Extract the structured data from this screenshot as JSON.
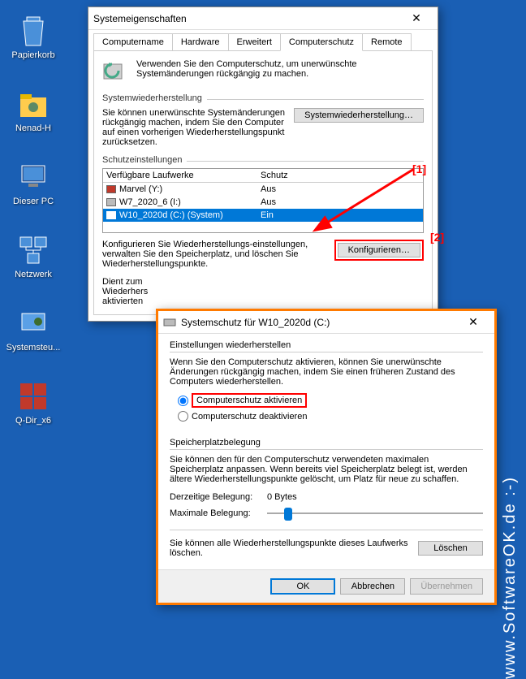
{
  "desktop": {
    "icons": [
      {
        "label": "Papierkorb"
      },
      {
        "label": "Nenad-H"
      },
      {
        "label": "Dieser PC"
      },
      {
        "label": "Netzwerk"
      },
      {
        "label": "Systemsteu..."
      },
      {
        "label": "Q-Dir_x6"
      }
    ]
  },
  "win1": {
    "title": "Systemeigenschaften",
    "tabs": [
      "Computername",
      "Hardware",
      "Erweitert",
      "Computerschutz",
      "Remote"
    ],
    "active_tab": "Computerschutz",
    "intro": "Verwenden Sie den Computerschutz, um unerwünschte Systemänderungen rückgängig zu machen.",
    "group_restore": "Systemwiederherstellung",
    "restore_text": "Sie können unerwünschte Systemänderungen rückgängig machen, indem Sie den Computer auf einen vorherigen Wiederherstellungspunkt zurücksetzen.",
    "restore_btn": "Systemwiederherstellung…",
    "group_protect": "Schutzeinstellungen",
    "col_drives": "Verfügbare Laufwerke",
    "col_protect": "Schutz",
    "drives": [
      {
        "name": "Marvel (Y:)",
        "protect": "Aus"
      },
      {
        "name": "W7_2020_6 (I:)",
        "protect": "Aus"
      },
      {
        "name": "W10_2020d (C:) (System)",
        "protect": "Ein"
      }
    ],
    "config_text": "Konfigurieren Sie Wiederherstellungs-einstellungen, verwalten Sie den Speicherplatz, und löschen Sie Wiederherstellungspunkte.",
    "config_btn": "Konfigurieren…",
    "create_text_partial": "Dient zum\nWiederhers\naktivierten"
  },
  "win2": {
    "title": "Systemschutz für W10_2020d (C:)",
    "group_restore": "Einstellungen wiederherstellen",
    "restore_intro": "Wenn Sie den Computerschutz aktivieren, können Sie unerwünschte Änderungen rückgängig machen, indem Sie einen früheren Zustand des Computers wiederherstellen.",
    "radio_on": "Computerschutz aktivieren",
    "radio_off": "Computerschutz deaktivieren",
    "group_space": "Speicherplatzbelegung",
    "space_intro": "Sie können den für den Computerschutz verwendeten maximalen Speicherplatz anpassen. Wenn bereits viel Speicherplatz belegt ist, werden ältere Wiederherstellungspunkte gelöscht, um Platz für neue zu schaffen.",
    "current_label": "Derzeitige Belegung:",
    "current_value": "0 Bytes",
    "max_label": "Maximale Belegung:",
    "delete_text": "Sie können alle Wiederherstellungspunkte dieses Laufwerks löschen.",
    "delete_btn": "Löschen",
    "ok": "OK",
    "cancel": "Abbrechen",
    "apply": "Übernehmen"
  },
  "annotations": {
    "a1": "[1]",
    "a2": "[2]"
  },
  "watermark": "www.SoftwareOK.de :-)"
}
